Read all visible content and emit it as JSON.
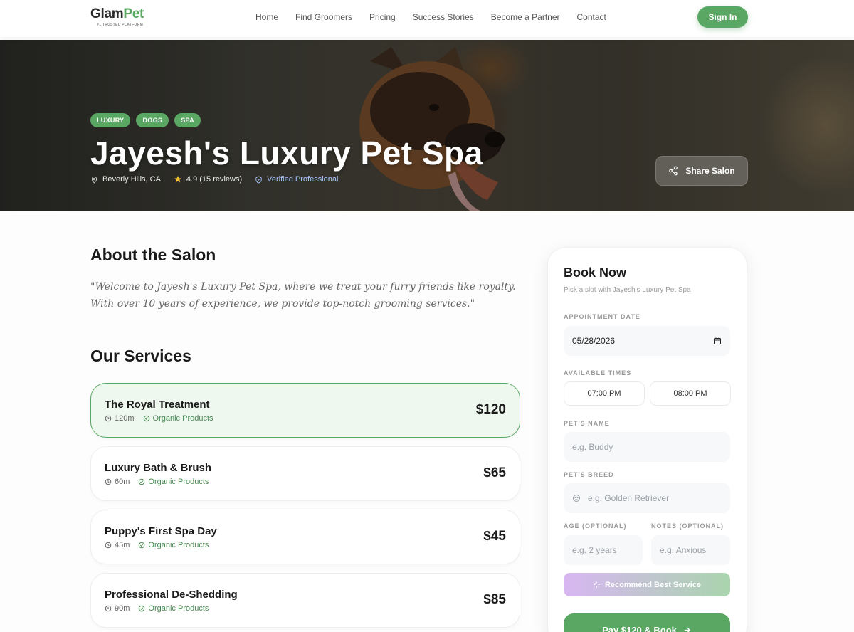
{
  "brand": {
    "name_a": "Glam",
    "name_b": "Pet",
    "tagline": "#1 TRUSTED PLATFORM"
  },
  "nav": {
    "links": [
      "Home",
      "Find Groomers",
      "Pricing",
      "Success Stories",
      "Become a Partner",
      "Contact"
    ],
    "signin": "Sign In"
  },
  "hero": {
    "tags": [
      "LUXURY",
      "DOGS",
      "SPA"
    ],
    "title": "Jayesh's Luxury Pet Spa",
    "location": "Beverly Hills, CA",
    "rating": "4.9 (15 reviews)",
    "verified": "Verified Professional",
    "share": "Share Salon"
  },
  "about": {
    "title": "About the Salon",
    "text": "\"Welcome to Jayesh's Luxury Pet Spa, where we treat your furry friends like royalty. With over 10 years of experience, we provide top-notch grooming services.\""
  },
  "services": {
    "title": "Our Services",
    "items": [
      {
        "name": "The Royal Treatment",
        "duration": "120m",
        "tag": "Organic Products",
        "price": "$120"
      },
      {
        "name": "Luxury Bath & Brush",
        "duration": "60m",
        "tag": "Organic Products",
        "price": "$65"
      },
      {
        "name": "Puppy's First Spa Day",
        "duration": "45m",
        "tag": "Organic Products",
        "price": "$45"
      },
      {
        "name": "Professional De-Shedding",
        "duration": "90m",
        "tag": "Organic Products",
        "price": "$85"
      }
    ]
  },
  "booking": {
    "title": "Book Now",
    "subtitle": "Pick a slot with Jayesh's Luxury Pet Spa",
    "date_label": "APPOINTMENT DATE",
    "date_value": "05/28/2026",
    "times_label": "AVAILABLE TIMES",
    "times": [
      "07:00 PM",
      "08:00 PM"
    ],
    "pet_name_label": "PET'S NAME",
    "pet_name_placeholder": "e.g. Buddy",
    "breed_label": "PET'S BREED",
    "breed_placeholder": "e.g. Golden Retriever",
    "age_label": "AGE (OPTIONAL)",
    "age_placeholder": "e.g. 2 years",
    "notes_label": "NOTES (OPTIONAL)",
    "notes_placeholder": "e.g. Anxious",
    "recommend": "Recommend Best Service",
    "pay": "Pay $120 & Book"
  }
}
